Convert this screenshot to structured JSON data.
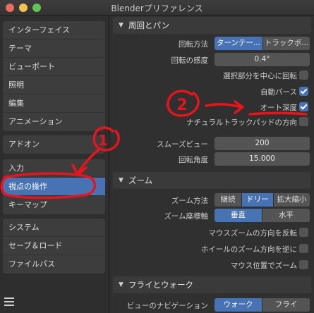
{
  "window": {
    "title": "Blenderプリファレンス"
  },
  "sidebar": {
    "groups": [
      [
        "インターフェイス",
        "テーマ",
        "ビューポート",
        "照明",
        "編集",
        "アニメーション"
      ],
      [
        "アドオン"
      ],
      [
        "入力",
        "視点の操作",
        "キーマップ"
      ],
      [
        "システム",
        "セーブ＆ロード",
        "ファイルパス"
      ]
    ],
    "active": "視点の操作",
    "menu_icon": "hamburger-icon"
  },
  "orbit_pan": {
    "title": "周回とパン",
    "orbit_method": {
      "label": "回転方法",
      "options": [
        "ターンテー...",
        "トラックボ..."
      ],
      "selected": "ターンテー..."
    },
    "orbit_sensitivity": {
      "label": "回転の感度",
      "value": "0.4°"
    },
    "orbit_around_selection": {
      "label": "選択部分を中心に回転",
      "checked": false
    },
    "auto_perspective": {
      "label": "自動パース",
      "checked": true
    },
    "auto_depth": {
      "label": "オート深度",
      "checked": true
    },
    "trackpad_natural": {
      "label": "ナチュラルトラックパッドの方向",
      "checked": false
    },
    "smooth_view": {
      "label": "スムーズビュー",
      "value": "200"
    },
    "rotation_angle": {
      "label": "回転角度",
      "value": "15.000"
    }
  },
  "zoom": {
    "title": "ズーム",
    "zoom_method": {
      "label": "ズーム方法",
      "options": [
        "継続",
        "ドリー",
        "拡大縮小"
      ],
      "selected": "ドリー"
    },
    "zoom_axis": {
      "label": "ズーム座標軸",
      "options": [
        "垂直",
        "水平"
      ],
      "selected": "垂直"
    },
    "invert_mouse_zoom": {
      "label": "マウスズームの方向を反転",
      "checked": false
    },
    "invert_wheel_zoom": {
      "label": "ホイールのズーム方向を逆に",
      "checked": false
    },
    "zoom_to_mouse": {
      "label": "マウス位置でズーム",
      "checked": false
    }
  },
  "fly_walk": {
    "title": "フライとウォーク",
    "navigation": {
      "label": "ビューのナビゲーション",
      "options": [
        "ウォーク",
        "フライ"
      ],
      "selected": "ウォーク"
    }
  },
  "annotations": {
    "marker_1": "1",
    "marker_2": "2",
    "ink_color": "#e8141c"
  }
}
